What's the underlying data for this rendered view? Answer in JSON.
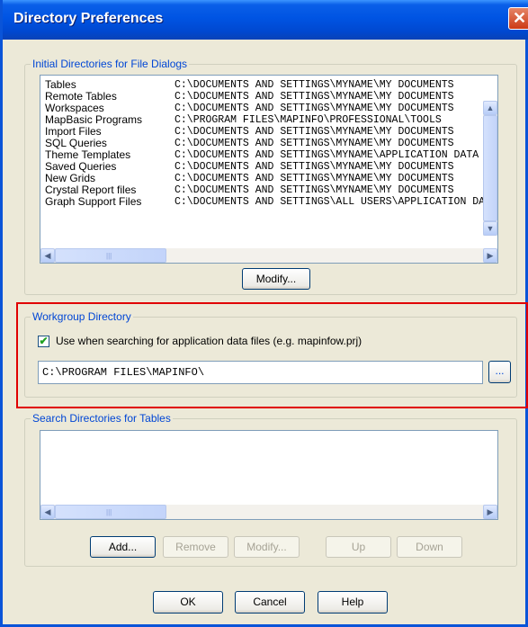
{
  "window": {
    "title": "Directory Preferences",
    "close_label": "✕"
  },
  "initial_dirs": {
    "group_label": "Initial Directories for File Dialogs",
    "rows": [
      {
        "name": "Tables",
        "path": "C:\\DOCUMENTS AND SETTINGS\\MYNAME\\MY DOCUMENTS"
      },
      {
        "name": "Remote Tables",
        "path": "C:\\DOCUMENTS AND SETTINGS\\MYNAME\\MY DOCUMENTS"
      },
      {
        "name": "Workspaces",
        "path": "C:\\DOCUMENTS AND SETTINGS\\MYNAME\\MY DOCUMENTS"
      },
      {
        "name": "MapBasic Programs",
        "path": "C:\\PROGRAM FILES\\MAPINFO\\PROFESSIONAL\\TOOLS"
      },
      {
        "name": "Import Files",
        "path": "C:\\DOCUMENTS AND SETTINGS\\MYNAME\\MY DOCUMENTS"
      },
      {
        "name": "SQL Queries",
        "path": "C:\\DOCUMENTS AND SETTINGS\\MYNAME\\MY DOCUMENTS"
      },
      {
        "name": "Theme Templates",
        "path": "C:\\DOCUMENTS AND SETTINGS\\MYNAME\\APPLICATION DATA"
      },
      {
        "name": "Saved Queries",
        "path": "C:\\DOCUMENTS AND SETTINGS\\MYNAME\\MY DOCUMENTS"
      },
      {
        "name": "New Grids",
        "path": "C:\\DOCUMENTS AND SETTINGS\\MYNAME\\MY DOCUMENTS"
      },
      {
        "name": "Crystal Report files",
        "path": "C:\\DOCUMENTS AND SETTINGS\\MYNAME\\MY DOCUMENTS"
      },
      {
        "name": "Graph Support Files",
        "path": "C:\\DOCUMENTS AND SETTINGS\\ALL USERS\\APPLICATION DATA"
      }
    ],
    "modify_label": "Modify..."
  },
  "workgroup": {
    "group_label": "Workgroup Directory",
    "checkbox_checked": true,
    "checkbox_label": "Use when searching for application data files (e.g. mapinfow.prj)",
    "path_value": "C:\\PROGRAM FILES\\MAPINFO\\",
    "browse_label": "..."
  },
  "search_dirs": {
    "group_label": "Search Directories for Tables",
    "buttons": {
      "add": "Add...",
      "remove": "Remove",
      "modify": "Modify...",
      "up": "Up",
      "down": "Down"
    }
  },
  "footer": {
    "ok": "OK",
    "cancel": "Cancel",
    "help": "Help"
  },
  "icons": {
    "scroll_up": "▲",
    "scroll_down": "▼",
    "scroll_left": "◀",
    "scroll_right": "▶",
    "grip": "|||",
    "check": "✔"
  }
}
